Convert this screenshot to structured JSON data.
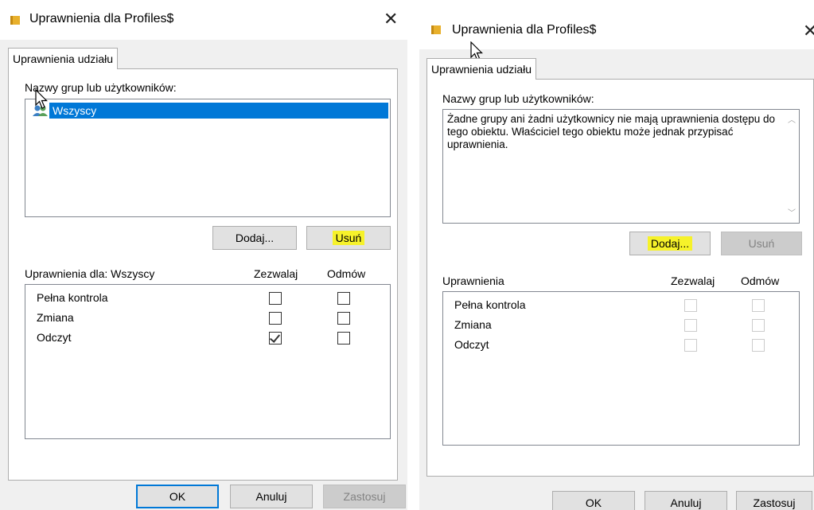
{
  "dialog_left": {
    "title": "Uprawnienia dla Profiles$",
    "tab_label": "Uprawnienia udziału",
    "groups_label": "Nazwy grup lub użytkowników:",
    "selected_user": "Wszyscy",
    "add_button": "Dodaj...",
    "remove_button": "Usuń",
    "perms_header": "Uprawnienia dla: Wszyscy",
    "allow_header": "Zezwalaj",
    "deny_header": "Odmów",
    "permissions": [
      {
        "name": "Pełna kontrola",
        "allow": false,
        "deny": false
      },
      {
        "name": "Zmiana",
        "allow": false,
        "deny": false
      },
      {
        "name": "Odczyt",
        "allow": true,
        "deny": false
      }
    ],
    "ok_button": "OK",
    "cancel_button": "Anuluj",
    "apply_button": "Zastosuj"
  },
  "dialog_right": {
    "title": "Uprawnienia dla Profiles$",
    "tab_label": "Uprawnienia udziału",
    "groups_label": "Nazwy grup lub użytkowników:",
    "message": "Żadne grupy ani żadni użytkownicy nie mają uprawnienia dostępu do tego obiektu. Właściciel tego obiektu może jednak przypisać uprawnienia.",
    "add_button": "Dodaj...",
    "remove_button": "Usuń",
    "perms_header": "Uprawnienia",
    "allow_header": "Zezwalaj",
    "deny_header": "Odmów",
    "permissions": [
      {
        "name": "Pełna kontrola",
        "allow": false,
        "deny": false
      },
      {
        "name": "Zmiana",
        "allow": false,
        "deny": false
      },
      {
        "name": "Odczyt",
        "allow": false,
        "deny": false
      }
    ],
    "ok_button": "OK",
    "cancel_button": "Anuluj",
    "apply_button": "Zastosuj"
  },
  "colors": {
    "highlight": "#f6f22a",
    "selection": "#0078d7",
    "folder": "#e8b02c"
  }
}
